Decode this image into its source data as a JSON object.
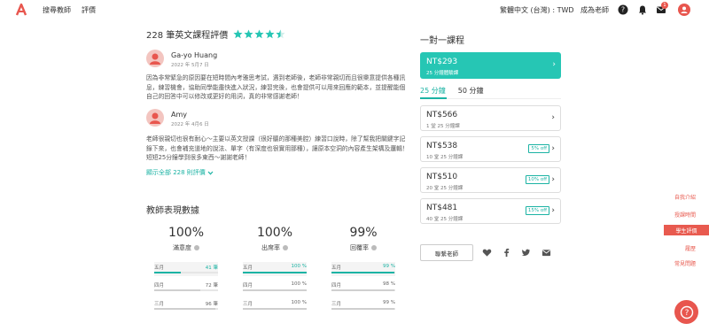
{
  "nav": {
    "link1": "搜尋教師",
    "link2": "評價",
    "locale": "繁體中文 (台灣) : TWD",
    "become_teacher": "成為老師",
    "notif_count": "1"
  },
  "reviews": {
    "title": "228 筆英文課程評價",
    "rating_stars": 4.5,
    "items": [
      {
        "initial": "G",
        "name": "Ga-yo Huang",
        "date": "2022 年 5月7 日",
        "text": "因為非常緊急的原因要在短時間內考雅思考試，遇到老師後，老師非常親切而且很樂意提供各種訊息，練習機會，協助同學能盡快進入狀況，練習完後，也會提供可以用來回應的範本，並提醒能個自己的回答中可以修改或更好的用詞，真的非常感謝老師！"
      },
      {
        "initial": "A",
        "name": "Amy",
        "date": "2022 年 4月6 日",
        "text": "老師很親切也很有耐心～主要以英文授課（很好聽的那種美腔）練習口說時，除了幫我把關鍵字記錄下來，也會補充道地的說法、單字（有深度也很實用那種），讓原本空洞的內容產生架構及邏輯！短短25分鐘學到很多東西～謝謝老師！"
      }
    ],
    "show_all": "顯示全部 228 則評價"
  },
  "performance": {
    "title": "教師表現數據",
    "metrics": [
      {
        "value": "100%",
        "label": "滿意度",
        "rows": [
          {
            "month": "五月",
            "value": "41 筆",
            "pct": 0.41
          },
          {
            "month": "四月",
            "value": "72 筆",
            "pct": 0.72
          },
          {
            "month": "三月",
            "value": "96 筆",
            "pct": 0.96
          }
        ]
      },
      {
        "value": "100%",
        "label": "出席率",
        "rows": [
          {
            "month": "五月",
            "value": "100 %",
            "pct": 1.0
          },
          {
            "month": "四月",
            "value": "100 %",
            "pct": 1.0
          },
          {
            "month": "三月",
            "value": "100 %",
            "pct": 1.0
          }
        ]
      },
      {
        "value": "99%",
        "label": "回覆率",
        "rows": [
          {
            "month": "五月",
            "value": "99 %",
            "pct": 0.99
          },
          {
            "month": "四月",
            "value": "98 %",
            "pct": 0.98
          },
          {
            "month": "三月",
            "value": "99 %",
            "pct": 0.99
          }
        ]
      }
    ]
  },
  "lesson": {
    "title": "一對一課程",
    "trial": {
      "price": "NT$293",
      "sub": "25 分鐘體驗課"
    },
    "tabs": [
      "25 分鐘",
      "50 分鐘"
    ],
    "packages": [
      {
        "price": "NT$566",
        "sub": "1 堂 25 分鐘課",
        "badge": ""
      },
      {
        "price": "NT$538",
        "sub": "10 堂 25 分鐘課",
        "badge": "5% off"
      },
      {
        "price": "NT$510",
        "sub": "20 堂 25 分鐘課",
        "badge": "10% off"
      },
      {
        "price": "NT$481",
        "sub": "40 堂 25 分鐘課",
        "badge": "15% off"
      }
    ],
    "contact": "聯繫老師"
  },
  "side_nav": [
    "自我介紹",
    "授課時間",
    "學生評價",
    "履歷",
    "常見問題"
  ],
  "colors": {
    "accent": "#1cb3a4",
    "brand": "#e8564e",
    "star": "#26c6b4"
  }
}
